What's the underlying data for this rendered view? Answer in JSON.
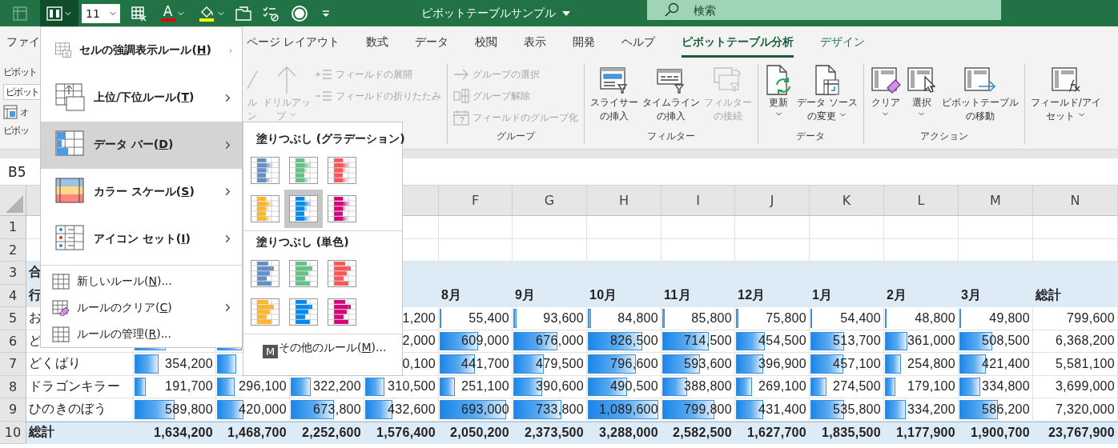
{
  "title_bar": {
    "quick_access": [
      {
        "kind": "pivot_table",
        "disabled": true,
        "open": false,
        "dropdown": false
      },
      {
        "kind": "conditional_format",
        "disabled": false,
        "open": true,
        "dropdown": true
      },
      {
        "kind": "font_size",
        "value": "11",
        "disabled": false,
        "open": false,
        "dropdown": true
      },
      {
        "kind": "table_format",
        "disabled": false,
        "open": false,
        "dropdown": false
      },
      {
        "kind": "font_color",
        "glyph": "A",
        "disabled": false,
        "open": false,
        "dropdown": true
      },
      {
        "kind": "fill_color",
        "disabled": false,
        "open": false,
        "dropdown": true
      },
      {
        "kind": "print_preview",
        "disabled": false,
        "open": false,
        "dropdown": false
      },
      {
        "kind": "spelling",
        "disabled": false,
        "open": false,
        "dropdown": false
      },
      {
        "kind": "record",
        "disabled": false,
        "open": false,
        "dropdown": false
      },
      {
        "kind": "customize",
        "disabled": false,
        "open": false,
        "dropdown": false
      }
    ],
    "title": "ピボットテーブルサンプル",
    "search": {
      "placeholder": "検索"
    }
  },
  "ribbon_tabs": [
    {
      "label": "ファイ",
      "selected": false,
      "contextual": false
    },
    {
      "label": "ページ レイアウト",
      "selected": false,
      "contextual": false
    },
    {
      "label": "数式",
      "selected": false,
      "contextual": false
    },
    {
      "label": "データ",
      "selected": false,
      "contextual": false
    },
    {
      "label": "校閲",
      "selected": false,
      "contextual": false
    },
    {
      "label": "表示",
      "selected": false,
      "contextual": false
    },
    {
      "label": "開発",
      "selected": false,
      "contextual": false
    },
    {
      "label": "ヘルプ",
      "selected": false,
      "contextual": false
    },
    {
      "label": "ピボットテーブル分析",
      "selected": true,
      "contextual": true
    },
    {
      "label": "デザイン",
      "selected": false,
      "contextual": true
    }
  ],
  "ribbon": {
    "pivot": {
      "caption": "ピボット",
      "name_field": "ピボット",
      "options": "オ",
      "label": "ピボッ"
    },
    "groups": [
      {
        "large": [
          {
            "kind": "field_settings",
            "lines": [
              "ル",
              "ン"
            ],
            "disabled": true,
            "dropdown": false
          },
          {
            "kind": "drill_up",
            "lines": [
              "ドリルアッ",
              "プ"
            ],
            "disabled": true,
            "dropdown": true
          }
        ],
        "small": [
          {
            "kind": "expand",
            "text": "フィールドの展開",
            "disabled": true
          },
          {
            "kind": "collapse",
            "text": "フィールドの折りたたみ",
            "disabled": true
          }
        ]
      },
      {
        "label": "グループ",
        "small": [
          {
            "kind": "group_selection",
            "text": "グループの選択",
            "disabled": true
          },
          {
            "kind": "ungroup",
            "text": "グループ解除",
            "disabled": true
          },
          {
            "kind": "group_field",
            "text": "フィールドのグループ化",
            "disabled": true
          }
        ]
      },
      {
        "label": "フィルター",
        "large": [
          {
            "kind": "slicer",
            "lines": [
              "スライサー",
              "の挿入"
            ],
            "disabled": false,
            "dropdown": false
          },
          {
            "kind": "timeline",
            "lines": [
              "タイムライン",
              "の挿入"
            ],
            "disabled": false,
            "dropdown": false
          },
          {
            "kind": "filter_connections",
            "lines": [
              "フィルター",
              "の接続"
            ],
            "disabled": true,
            "dropdown": false
          }
        ]
      },
      {
        "label": "データ",
        "large": [
          {
            "kind": "refresh",
            "lines": [
              "更新"
            ],
            "disabled": false,
            "dropdown": true
          },
          {
            "kind": "change_source",
            "lines": [
              "データ ソース",
              "の変更"
            ],
            "disabled": false,
            "dropdown": true
          }
        ]
      },
      {
        "label": "アクション",
        "large": [
          {
            "kind": "clear",
            "lines": [
              "クリア"
            ],
            "disabled": false,
            "dropdown": true
          },
          {
            "kind": "select",
            "lines": [
              "選択"
            ],
            "disabled": false,
            "dropdown": true
          },
          {
            "kind": "move",
            "lines": [
              "ピボットテーブル",
              "の移動"
            ],
            "disabled": false,
            "dropdown": false
          }
        ]
      },
      {
        "large": [
          {
            "kind": "fields_items",
            "lines": [
              "フィールド/アイ",
              "セット"
            ],
            "disabled": false,
            "dropdown": true
          }
        ]
      }
    ]
  },
  "formula_bar": {
    "name_box": "B5"
  },
  "grid": {
    "column_letters": [
      "F",
      "G",
      "H",
      "I",
      "J",
      "K",
      "L",
      "M",
      "N"
    ],
    "rows": [
      {
        "number": "1",
        "kind": "blank"
      },
      {
        "number": "2",
        "kind": "blank"
      },
      {
        "number": "3",
        "kind": "pivot_title",
        "label": "合"
      },
      {
        "number": "4",
        "kind": "pivot_header",
        "label": "行",
        "cells": [
          {},
          {},
          {},
          {},
          {
            "text": "8月"
          },
          {
            "text": "9月"
          },
          {
            "text": "10月"
          },
          {
            "text": "11月"
          },
          {
            "text": "12月"
          },
          {
            "text": "1月"
          },
          {
            "text": "2月"
          },
          {
            "text": "3月"
          },
          {
            "text": "総計"
          }
        ]
      },
      {
        "number": "5",
        "kind": "data",
        "label": "お",
        "cells": [
          {},
          {},
          {},
          {
            "text": "1,200"
          },
          {
            "text": "55,400",
            "level": 0.04
          },
          {
            "text": "93,600",
            "level": 0.07
          },
          {
            "text": "84,800",
            "level": 0.06
          },
          {
            "text": "85,800",
            "level": 0.06
          },
          {
            "text": "75,800",
            "level": 0.05
          },
          {
            "text": "54,400",
            "level": 0.04
          },
          {
            "text": "48,800",
            "level": 0.04
          },
          {
            "text": "49,800",
            "level": 0.03
          },
          {
            "text": "799,600"
          }
        ]
      },
      {
        "number": "6",
        "kind": "data",
        "label": "ど",
        "cells": [
          {
            "level": 0.4
          },
          {
            "level": 0.36
          },
          {},
          {
            "text": "2,000"
          },
          {
            "text": "609,000",
            "level": 0.55
          },
          {
            "text": "676,000",
            "level": 0.62
          },
          {
            "text": "826,500",
            "level": 0.76
          },
          {
            "text": "714,500",
            "level": 0.66
          },
          {
            "text": "454,500",
            "level": 0.41
          },
          {
            "text": "513,700",
            "level": 0.48
          },
          {
            "text": "361,000",
            "level": 0.33
          },
          {
            "text": "508,500",
            "level": 0.47
          },
          {
            "text": "6,368,200"
          }
        ]
      },
      {
        "number": "7",
        "kind": "data",
        "label": "どくばり",
        "cells": [
          {
            "text": "354,200",
            "level": 0.31
          },
          {
            "level": 0.29
          },
          {},
          {
            "text": "0,100"
          },
          {
            "text": "441,700",
            "level": 0.5
          },
          {
            "text": "479,500",
            "level": 0.43
          },
          {
            "text": "796,600",
            "level": 0.67
          },
          {
            "text": "593,600",
            "level": 0.54
          },
          {
            "text": "396,900",
            "level": 0.39
          },
          {
            "text": "457,100",
            "level": 0.47
          },
          {
            "text": "254,800",
            "level": 0.24
          },
          {
            "text": "421,400",
            "level": 0.38
          },
          {
            "text": "5,581,100"
          }
        ]
      },
      {
        "number": "8",
        "kind": "data",
        "label": "ドラゴンキラー",
        "cells": [
          {
            "text": "191,700",
            "level": 0.16
          },
          {
            "text": "296,100",
            "level": 0.26
          },
          {
            "text": "322,200",
            "level": 0.29
          },
          {
            "text": "310,500",
            "level": 0.28
          },
          {
            "text": "251,100",
            "level": 0.23
          },
          {
            "text": "390,600",
            "level": 0.41
          },
          {
            "text": "490,500",
            "level": 0.55
          },
          {
            "text": "388,800",
            "level": 0.36
          },
          {
            "text": "269,100",
            "level": 0.24
          },
          {
            "text": "274,500",
            "level": 0.24
          },
          {
            "text": "179,100",
            "level": 0.16
          },
          {
            "text": "334,800",
            "level": 0.3
          },
          {
            "text": "3,699,000"
          }
        ]
      },
      {
        "number": "9",
        "kind": "data",
        "label": "ひのきのぼう",
        "cells": [
          {
            "text": "589,800",
            "level": 0.51
          },
          {
            "text": "420,000",
            "level": 0.38
          },
          {
            "text": "673,800",
            "level": 0.61
          },
          {
            "text": "432,600",
            "level": 0.39
          },
          {
            "text": "693,000",
            "level": 0.93
          },
          {
            "text": "733,800",
            "level": 0.67
          },
          {
            "text": "1,089,600",
            "level": 0.98
          },
          {
            "text": "799,800",
            "level": 0.74
          },
          {
            "text": "431,400",
            "level": 0.39
          },
          {
            "text": "535,800",
            "level": 0.48
          },
          {
            "text": "334,200",
            "level": 0.3
          },
          {
            "text": "586,200",
            "level": 0.54
          },
          {
            "text": "7,320,000"
          }
        ]
      },
      {
        "number": "10",
        "kind": "total",
        "label": "総計",
        "cells": [
          {
            "text": "1,634,200"
          },
          {
            "text": "1,468,700"
          },
          {
            "text": "2,252,600"
          },
          {
            "text": "1,576,400"
          },
          {
            "text": "2,050,200"
          },
          {
            "text": "2,373,500"
          },
          {
            "text": "3,288,000"
          },
          {
            "text": "2,582,500"
          },
          {
            "text": "1,627,700"
          },
          {
            "text": "1,835,500"
          },
          {
            "text": "1,177,900"
          },
          {
            "text": "1,900,700"
          },
          {
            "text": "23,767,900"
          }
        ]
      }
    ]
  },
  "menu": {
    "large_items": [
      {
        "kind": "highlight",
        "label_start": "セルの強調表示ルール(",
        "access_key": "H",
        "label_end": ")",
        "submenu": true,
        "selected": false
      },
      {
        "kind": "top_bottom",
        "label_start": "上位/下位ルール(",
        "access_key": "T",
        "label_end": ")",
        "submenu": true,
        "selected": false
      },
      {
        "kind": "data_bar",
        "label_start": "データ バー(",
        "access_key": "D",
        "label_end": ")",
        "submenu": true,
        "selected": true
      },
      {
        "kind": "color_scale",
        "label_start": "カラー スケール(",
        "access_key": "S",
        "label_end": ")",
        "submenu": true,
        "selected": false
      },
      {
        "kind": "icon_set",
        "label_start": "アイコン セット(",
        "access_key": "I",
        "label_end": ")",
        "submenu": true,
        "selected": false
      }
    ],
    "small_items": [
      {
        "kind": "new_rule",
        "label_start": "新しいルール(",
        "access_key": "N",
        "label_end": ")...",
        "submenu": false
      },
      {
        "kind": "clear_rules",
        "label_start": "ルールのクリア(",
        "access_key": "C",
        "label_end": ")",
        "submenu": true
      },
      {
        "kind": "manage_rules",
        "label_start": "ルールの管理(",
        "access_key": "R",
        "label_end": ")...",
        "submenu": false
      }
    ]
  },
  "submenu": {
    "sections": [
      {
        "title": "塗りつぶし (グラデーション)",
        "kind": "gradient",
        "swatches": [
          {
            "color": "#638ec6",
            "selected": false
          },
          {
            "color": "#63c384",
            "selected": false
          },
          {
            "color": "#ff555a",
            "selected": false
          },
          {
            "color": "#ffb628",
            "selected": false
          },
          {
            "color": "#008aef",
            "selected": true
          },
          {
            "color": "#d6007b",
            "selected": false
          }
        ]
      },
      {
        "title": "塗りつぶし (単色)",
        "kind": "solid",
        "swatches": [
          {
            "color": "#638ec6",
            "selected": false
          },
          {
            "color": "#63c384",
            "selected": false
          },
          {
            "color": "#ff555a",
            "selected": false
          },
          {
            "color": "#ffb628",
            "selected": false
          },
          {
            "color": "#008aef",
            "selected": false
          },
          {
            "color": "#d6007b",
            "selected": false
          }
        ]
      }
    ],
    "more": {
      "label_start": "その他のルール(",
      "access_key": "M",
      "label_end": ")...",
      "key_tip": "M"
    }
  }
}
